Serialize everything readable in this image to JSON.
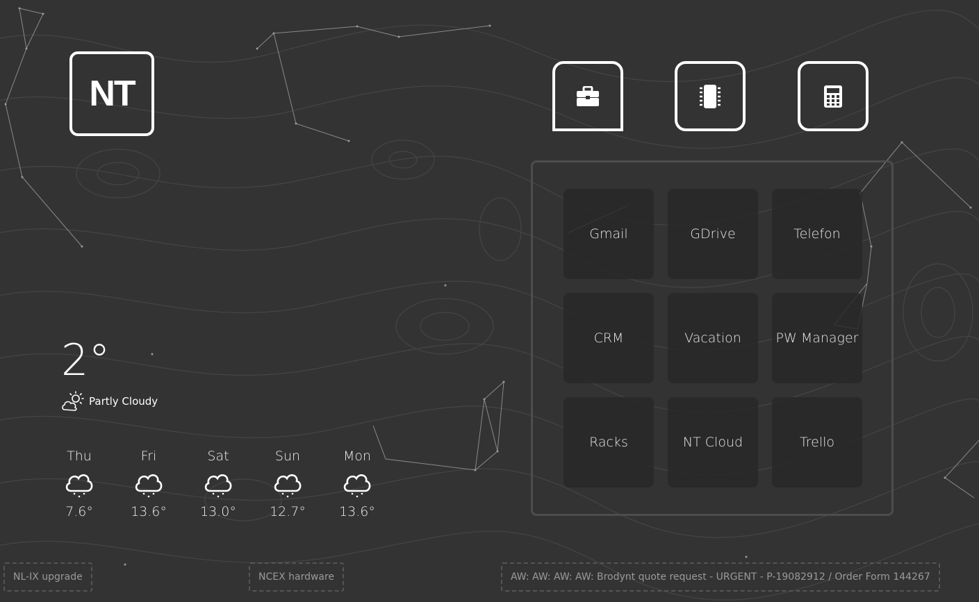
{
  "logo": {
    "text": "NT"
  },
  "toolbar": {
    "items": [
      {
        "name": "briefcase-icon",
        "active": true
      },
      {
        "name": "chip-icon",
        "active": false
      },
      {
        "name": "calculator-icon",
        "active": false
      }
    ]
  },
  "links": [
    {
      "label": "Gmail"
    },
    {
      "label": "GDrive"
    },
    {
      "label": "Telefon"
    },
    {
      "label": "CRM"
    },
    {
      "label": "Vacation"
    },
    {
      "label": "PW Manager"
    },
    {
      "label": "Racks"
    },
    {
      "label": "NT Cloud"
    },
    {
      "label": "Trello"
    }
  ],
  "weather": {
    "current_temp": "2°",
    "condition": "Partly Cloudy",
    "condition_icon": "partly-cloudy-icon",
    "forecast": [
      {
        "day": "Thu",
        "temp": "7.6°",
        "icon": "rain-cloud-icon"
      },
      {
        "day": "Fri",
        "temp": "13.6°",
        "icon": "rain-cloud-icon"
      },
      {
        "day": "Sat",
        "temp": "13.0°",
        "icon": "rain-cloud-icon"
      },
      {
        "day": "Sun",
        "temp": "12.7°",
        "icon": "rain-cloud-icon"
      },
      {
        "day": "Mon",
        "temp": "13.6°",
        "icon": "rain-cloud-icon"
      }
    ]
  },
  "tickets": [
    {
      "label": "NL-IX upgrade"
    },
    {
      "label": "NCEX hardware"
    },
    {
      "label": "AW: AW: AW: AW: Brodynt quote request - URGENT - P-19082912 / Order Form 144267"
    }
  ],
  "colors": {
    "background": "#333333",
    "foreground": "#ffffff",
    "tile": "#282828"
  }
}
